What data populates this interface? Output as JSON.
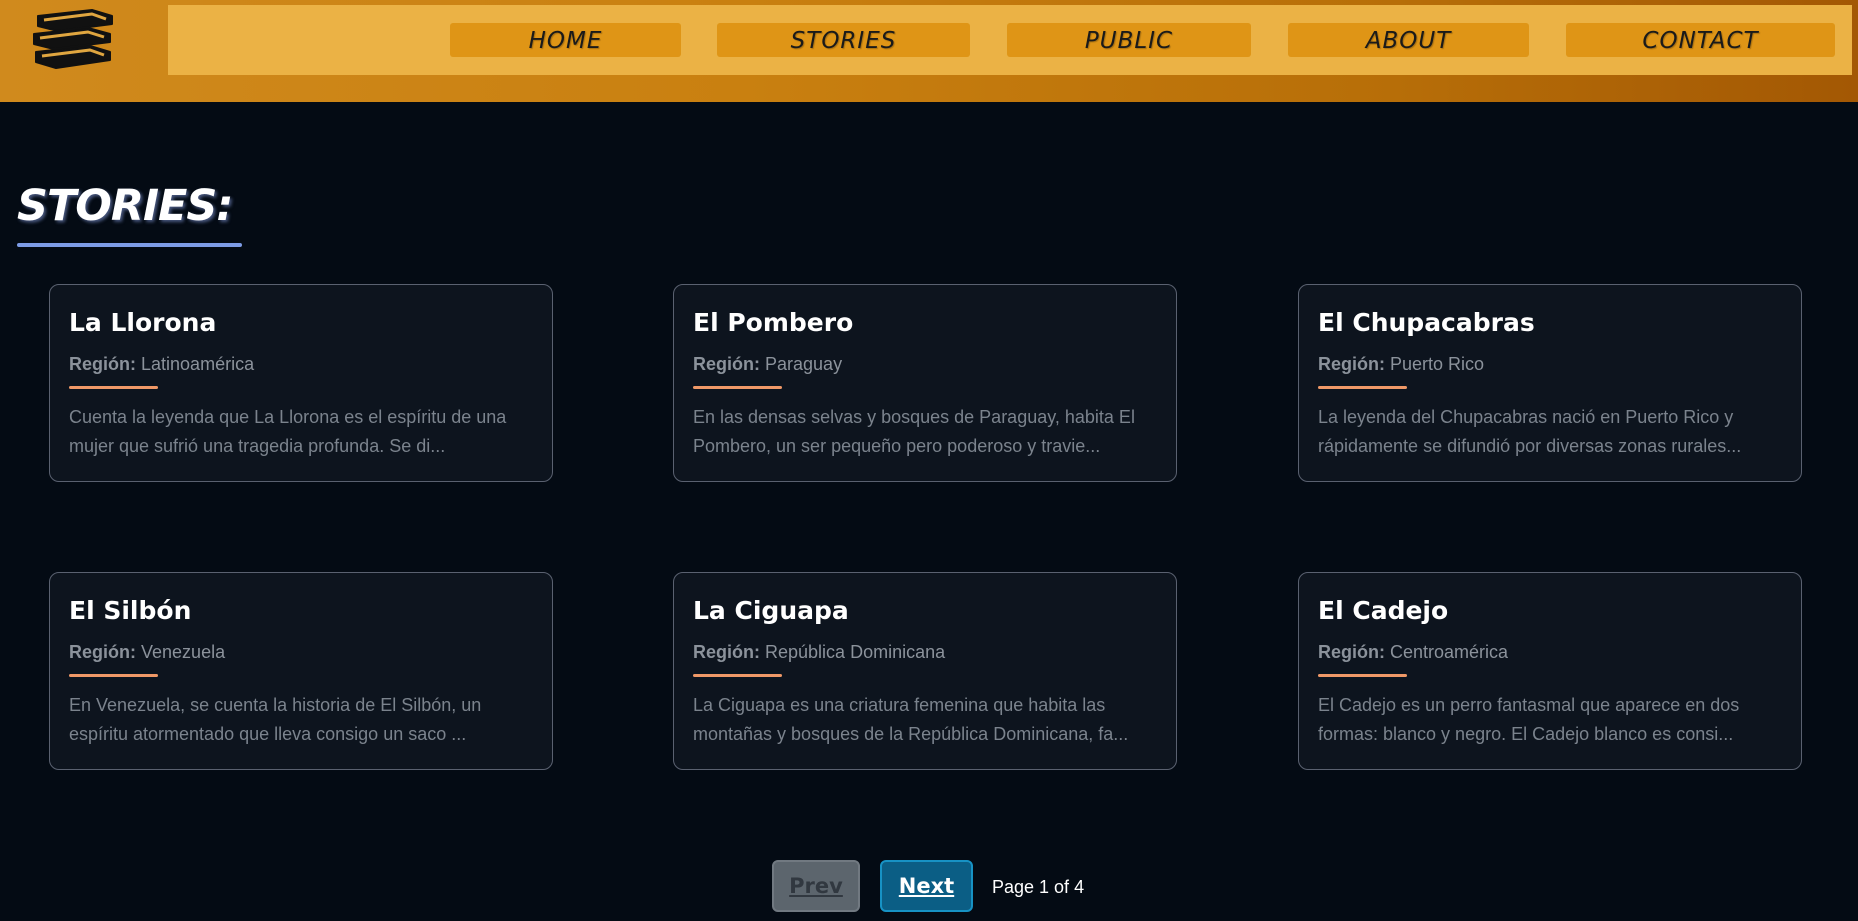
{
  "nav": {
    "logo_icon": "stacked-books-icon",
    "items": [
      {
        "label": "HOME"
      },
      {
        "label": "STORIES"
      },
      {
        "label": "PUBLIC"
      },
      {
        "label": "ABOUT"
      },
      {
        "label": "CONTACT"
      }
    ]
  },
  "colors": {
    "header_gradient_start": "#d08a1d",
    "header_gradient_end": "#a35804",
    "nav_bar": "#ebb245",
    "nav_button": "#df9516",
    "background": "#040b14",
    "card_background": "#0d141e",
    "title_underline": "#7d9ce6",
    "card_divider": "#ef9867",
    "next_button": "#0b5e85",
    "prev_button": "#6c757d"
  },
  "page": {
    "title": "STORIES:"
  },
  "stories": [
    {
      "title": "La Llorona",
      "region_label": "Región:",
      "region": "Latinoamérica",
      "excerpt": "Cuenta la leyenda que La Llorona es el espíritu de una mujer que sufrió una tragedia profunda. Se di..."
    },
    {
      "title": "El Pombero",
      "region_label": "Región:",
      "region": "Paraguay",
      "excerpt": "En las densas selvas y bosques de Paraguay, habita El Pombero, un ser pequeño pero poderoso y travie..."
    },
    {
      "title": "El Chupacabras",
      "region_label": "Región:",
      "region": "Puerto Rico",
      "excerpt": "La leyenda del Chupacabras nació en Puerto Rico y rápidamente se difundió por diversas zonas rurales..."
    },
    {
      "title": "El Silbón",
      "region_label": "Región:",
      "region": "Venezuela",
      "excerpt": "En Venezuela, se cuenta la historia de El Silbón, un espíritu atormentado que lleva consigo un saco ..."
    },
    {
      "title": "La Ciguapa",
      "region_label": "Región:",
      "region": "República Dominicana",
      "excerpt": "La Ciguapa es una criatura femenina que habita las montañas y bosques de la República Dominicana, fa..."
    },
    {
      "title": "El Cadejo",
      "region_label": "Región:",
      "region": "Centroamérica",
      "excerpt": "El Cadejo es un perro fantasmal que aparece en dos formas: blanco y negro. El Cadejo blanco es consi..."
    }
  ],
  "pagination": {
    "prev_label": "Prev",
    "next_label": "Next",
    "page_info": "Page 1 of 4",
    "current_page": 1,
    "total_pages": 4
  }
}
